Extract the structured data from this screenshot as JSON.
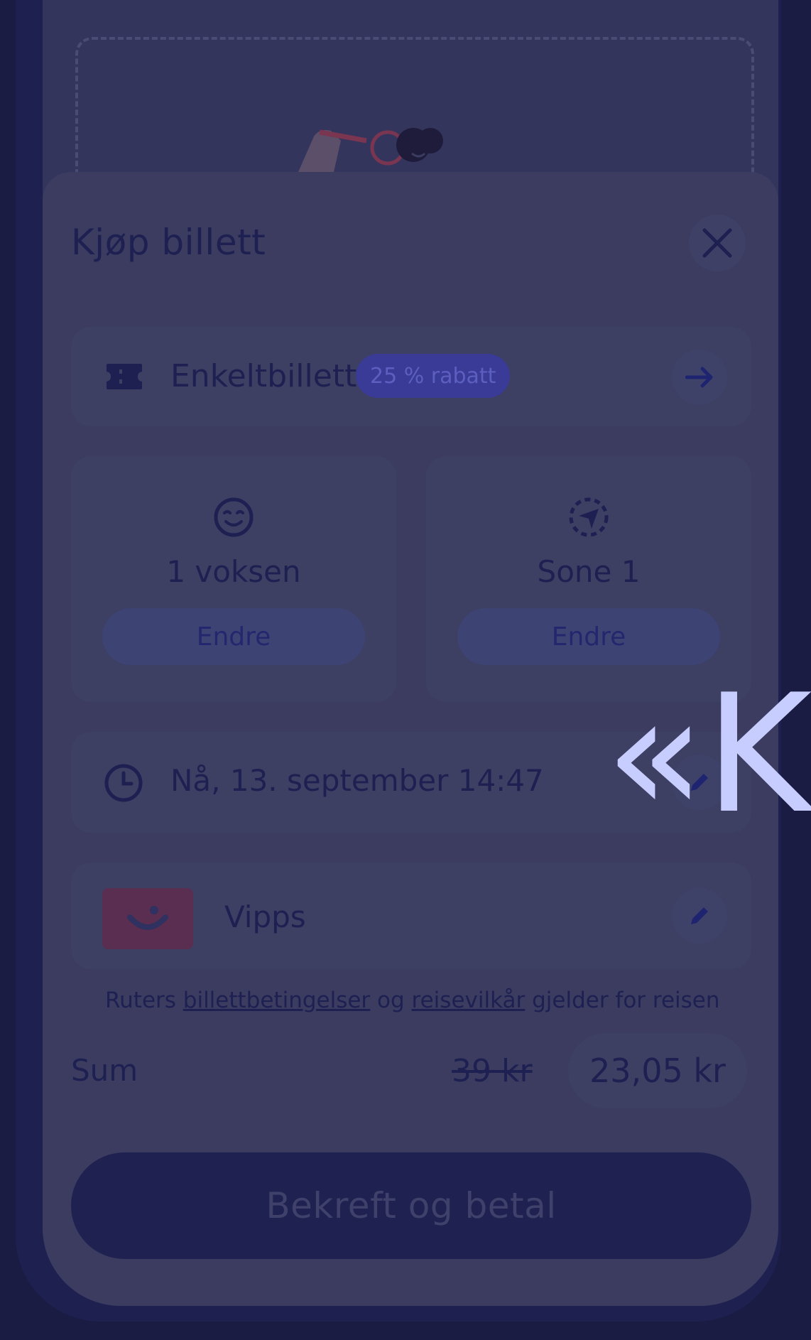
{
  "sheet": {
    "title": "Kjøp billett",
    "close_icon": "close-icon"
  },
  "ticket": {
    "label": "Enkeltbillett",
    "badge": "25 % rabatt",
    "icon": "ticket-icon",
    "arrow_icon": "arrow-right-icon"
  },
  "traveller": {
    "value": "1 voksen",
    "button": "Endre",
    "icon": "smiley-icon"
  },
  "zone": {
    "value": "Sone 1",
    "button": "Endre",
    "icon": "location-arrow-icon"
  },
  "time": {
    "label": "Nå, 13. september 14:47",
    "icon": "clock-icon",
    "edit_icon": "pencil-icon"
  },
  "payment": {
    "label": "Vipps",
    "logo": "vipps-logo",
    "edit_icon": "pencil-icon"
  },
  "terms": {
    "prefix": "Ruters ",
    "link1": "billettbetingelser",
    "middle": " og ",
    "link2": "reisevilkår",
    "suffix": " gjelder for reisen"
  },
  "summary": {
    "label": "Sum",
    "old_price": "39 kr",
    "price": "23,05 kr"
  },
  "confirm_button": "Bekreft og betal",
  "overlay_text": "«K",
  "colors": {
    "badge_bg": "#3a3b96",
    "vipps": "#5a2e50",
    "overlay_text": "#c8cdff"
  }
}
